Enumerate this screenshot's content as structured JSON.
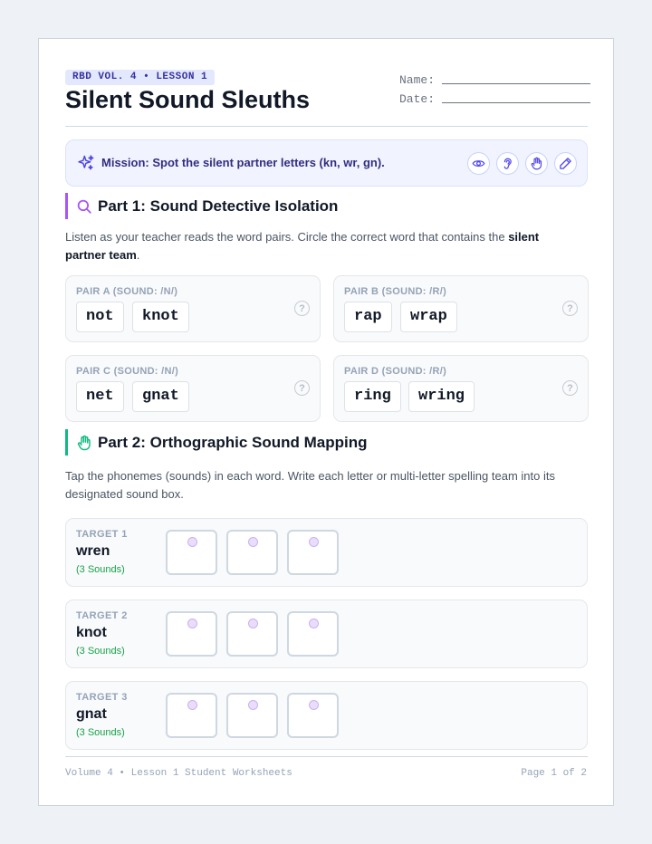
{
  "header": {
    "badge": "RBD VOL. 4 • LESSON 1",
    "title": "Silent Sound Sleuths",
    "name_label": "Name:",
    "date_label": "Date:"
  },
  "mission": {
    "text": "Mission: Spot the silent partner letters (kn, wr, gn).",
    "icon": "sparkle-icon",
    "tools": [
      "eye-icon",
      "ear-icon",
      "hand-icon",
      "pencil-icon"
    ]
  },
  "part1": {
    "title": "Part 1: Sound Detective Isolation",
    "icon": "search-icon",
    "accent": "#a855f7",
    "instructions_prefix": "Listen as your teacher reads the word pairs. Circle the correct word that contains the ",
    "instructions_bold": "silent partner team",
    "instructions_suffix": ".",
    "pairs": [
      {
        "label": "PAIR A (SOUND: /N/)",
        "words": [
          "not",
          "knot"
        ]
      },
      {
        "label": "PAIR B (SOUND: /R/)",
        "words": [
          "rap",
          "wrap"
        ]
      },
      {
        "label": "PAIR C (SOUND: /N/)",
        "words": [
          "net",
          "gnat"
        ]
      },
      {
        "label": "PAIR D (SOUND: /R/)",
        "words": [
          "ring",
          "wring"
        ]
      }
    ]
  },
  "part2": {
    "title": "Part 2: Orthographic Sound Mapping",
    "icon": "tap-hand-icon",
    "accent": "#10b981",
    "instructions": "Tap the phonemes (sounds) in each word. Write each letter or multi-letter spelling team into its designated sound box.",
    "targets": [
      {
        "label": "TARGET 1",
        "word": "wren",
        "sounds": "(3 Sounds)",
        "boxes": 3
      },
      {
        "label": "TARGET 2",
        "word": "knot",
        "sounds": "(3 Sounds)",
        "boxes": 3
      },
      {
        "label": "TARGET 3",
        "word": "gnat",
        "sounds": "(3 Sounds)",
        "boxes": 3
      }
    ]
  },
  "footer": {
    "left": "Volume 4 • Lesson 1 Student Worksheets",
    "right": "Page 1 of 2"
  }
}
